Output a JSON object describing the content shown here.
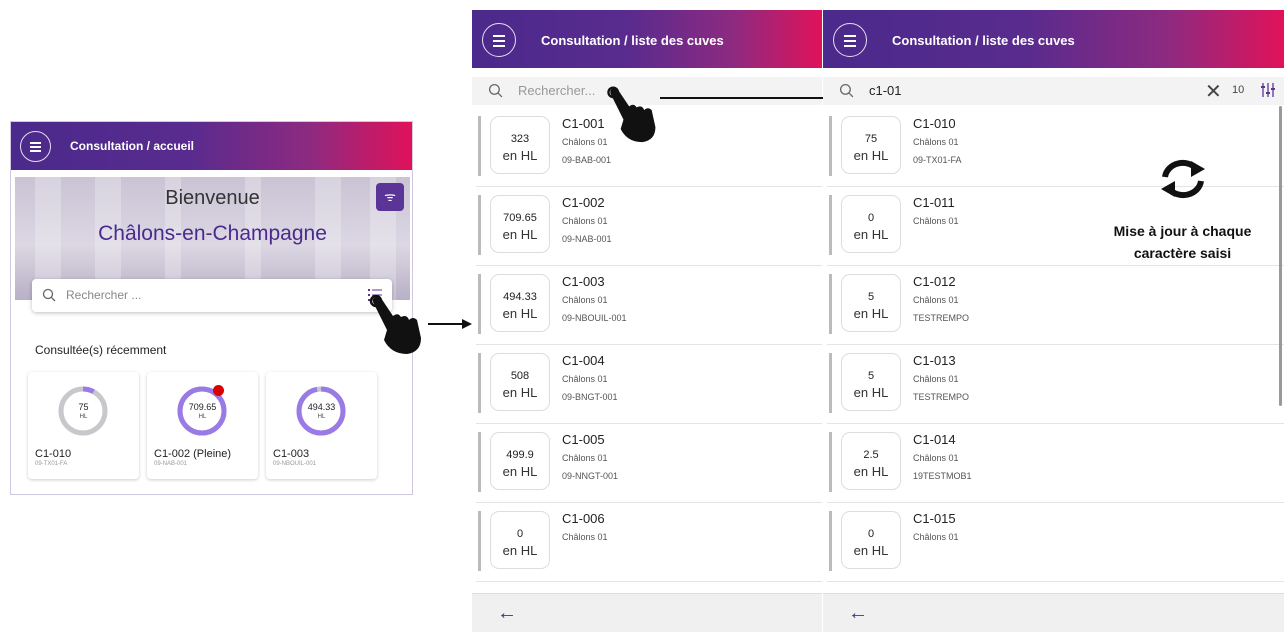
{
  "home": {
    "title": "Consultation / accueil",
    "welcome": "Bienvenue",
    "city": "Châlons-en-Champagne",
    "search_placeholder": "Rechercher ...",
    "recent_title": "Consultée(s) récemment",
    "recent": [
      {
        "value": "75",
        "unit": "HL",
        "name": "C1-010",
        "code": "09-TX01-FA",
        "fill": 0.08,
        "alert": false
      },
      {
        "value": "709.65",
        "unit": "HL",
        "name": "C1-002 (Pleine)",
        "code": "09-NAB-001",
        "fill": 1.0,
        "alert": true
      },
      {
        "value": "494.33",
        "unit": "HL",
        "name": "C1-003",
        "code": "09-NBOUIL-001",
        "fill": 0.97,
        "alert": false
      }
    ]
  },
  "list_screen": {
    "title": "Consultation / liste des cuves",
    "search_placeholder": "Rechercher...",
    "unit": "en HL",
    "items": [
      {
        "volume": "323",
        "name": "C1-001",
        "site": "Châlons 01",
        "code": "09-BAB-001"
      },
      {
        "volume": "709.65",
        "name": "C1-002",
        "site": "Châlons 01",
        "code": "09-NAB-001"
      },
      {
        "volume": "494.33",
        "name": "C1-003",
        "site": "Châlons 01",
        "code": "09-NBOUIL-001"
      },
      {
        "volume": "508",
        "name": "C1-004",
        "site": "Châlons 01",
        "code": "09-BNGT-001"
      },
      {
        "volume": "499.9",
        "name": "C1-005",
        "site": "Châlons 01",
        "code": "09-NNGT-001"
      },
      {
        "volume": "0",
        "name": "C1-006",
        "site": "Châlons 01",
        "code": ""
      }
    ]
  },
  "result_screen": {
    "title": "Consultation / liste des cuves",
    "query": "c1-01",
    "count": "10",
    "unit": "en HL",
    "items": [
      {
        "volume": "75",
        "name": "C1-010",
        "site": "Châlons 01",
        "code": "09-TX01-FA"
      },
      {
        "volume": "0",
        "name": "C1-011",
        "site": "Châlons 01",
        "code": ""
      },
      {
        "volume": "5",
        "name": "C1-012",
        "site": "Châlons 01",
        "code": "TESTREMPO"
      },
      {
        "volume": "5",
        "name": "C1-013",
        "site": "Châlons 01",
        "code": "TESTREMPO"
      },
      {
        "volume": "2.5",
        "name": "C1-014",
        "site": "Châlons 01",
        "code": "19TESTMOB1"
      },
      {
        "volume": "0",
        "name": "C1-015",
        "site": "Châlons 01",
        "code": ""
      }
    ]
  },
  "annotation": {
    "note_line1": "Mise à jour à chaque",
    "note_line2": "caractère saisi"
  },
  "colors": {
    "brand_purple": "#4a2a8c",
    "accent_pink": "#e0125a",
    "gauge_purple": "#9a7be6",
    "alert_red": "#dd0000"
  }
}
